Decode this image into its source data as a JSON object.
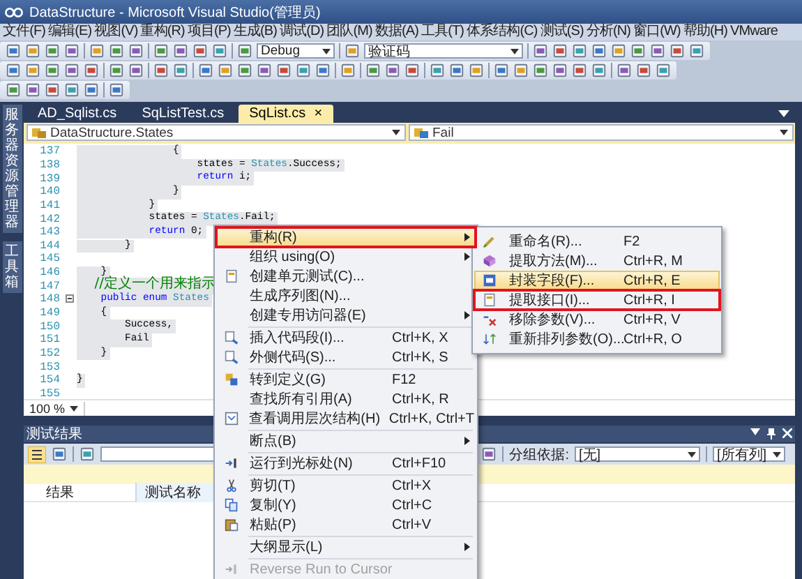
{
  "window": {
    "title": "DataStructure - Microsoft Visual Studio(管理员)"
  },
  "menu_bar": [
    "文件(F)",
    "编辑(E)",
    "视图(V)",
    "重构(R)",
    "项目(P)",
    "生成(B)",
    "调试(D)",
    "团队(M)",
    "数据(A)",
    "工具(T)",
    "体系结构(C)",
    "测试(S)",
    "分析(N)",
    "窗口(W)",
    "帮助(H)",
    "VMware"
  ],
  "toolbar": {
    "configuration": "Debug",
    "search_combo": "验证码"
  },
  "side_strip": [
    "服务器资源管理器",
    "工具箱"
  ],
  "tabs": [
    {
      "label": "AD_Sqlist.cs",
      "selected": false
    },
    {
      "label": "SqListTest.cs",
      "selected": false
    },
    {
      "label": "SqList.cs",
      "selected": true,
      "close": "×"
    }
  ],
  "nav_bar": {
    "type_combo": "DataStructure.States",
    "member_combo": "Fail"
  },
  "code_lines": [
    {
      "number": "137",
      "segments": [
        {
          "kind": "plain",
          "text": "                {"
        }
      ]
    },
    {
      "number": "138",
      "segments": [
        {
          "kind": "plain",
          "text": "                    states = "
        },
        {
          "kind": "type",
          "text": "States"
        },
        {
          "kind": "plain",
          "text": ".Success;"
        }
      ]
    },
    {
      "number": "139",
      "segments": [
        {
          "kind": "keyword",
          "text": "                    return"
        },
        {
          "kind": "plain",
          "text": " i;"
        }
      ]
    },
    {
      "number": "140",
      "segments": [
        {
          "kind": "plain",
          "text": "                }"
        }
      ]
    },
    {
      "number": "141",
      "segments": [
        {
          "kind": "plain",
          "text": "            }"
        }
      ]
    },
    {
      "number": "142",
      "segments": [
        {
          "kind": "plain",
          "text": "            states = "
        },
        {
          "kind": "type",
          "text": "States"
        },
        {
          "kind": "plain",
          "text": ".Fail;"
        }
      ]
    },
    {
      "number": "143",
      "segments": [
        {
          "kind": "keyword",
          "text": "            return"
        },
        {
          "kind": "plain",
          "text": " 0;"
        }
      ]
    },
    {
      "number": "144",
      "segments": [
        {
          "kind": "plain",
          "text": "        }"
        }
      ]
    },
    {
      "number": "145"
    },
    {
      "number": "146",
      "segments": [
        {
          "kind": "plain",
          "text": "    }"
        }
      ]
    },
    {
      "number": "147",
      "segments": [
        {
          "kind": "comment",
          "text": "    //定义一个用来指示"
        }
      ]
    },
    {
      "number": "148",
      "segments": [
        {
          "kind": "keyword",
          "text": "    public enum"
        },
        {
          "kind": "type",
          "text": " States"
        }
      ]
    },
    {
      "number": "149",
      "segments": [
        {
          "kind": "plain",
          "text": "    {"
        }
      ]
    },
    {
      "number": "150",
      "segments": [
        {
          "kind": "plain",
          "text": "        Success,"
        }
      ]
    },
    {
      "number": "151",
      "segments": [
        {
          "kind": "plain",
          "text": "        Fail"
        }
      ]
    },
    {
      "number": "152",
      "segments": [
        {
          "kind": "plain",
          "text": "    }"
        }
      ]
    },
    {
      "number": "153"
    },
    {
      "number": "154",
      "segments": [
        {
          "kind": "plain",
          "text": "}"
        }
      ]
    },
    {
      "number": "155"
    }
  ],
  "zoom": "100 %",
  "test_results": {
    "title": "测试结果",
    "group_label": "分组依据:",
    "group_combo": "[无]",
    "columns_combo": "[所有列]",
    "columns": [
      "结果",
      "测试名称"
    ]
  },
  "context_menu": [
    {
      "kind": "item",
      "label": "重构(R)",
      "submenu": true,
      "selected": true,
      "outlined": true,
      "disabled": false
    },
    {
      "kind": "item",
      "label": "组织 using(O)",
      "submenu": true,
      "selected": false,
      "outlined": false,
      "disabled": false
    },
    {
      "kind": "item",
      "label": "创建单元测试(C)...",
      "submenu": false,
      "selected": false,
      "outlined": false,
      "disabled": false
    },
    {
      "kind": "item",
      "label": "生成序列图(N)...",
      "submenu": false,
      "selected": false,
      "outlined": false,
      "disabled": false
    },
    {
      "kind": "item",
      "label": "创建专用访问器(E)",
      "submenu": true,
      "selected": false,
      "outlined": false,
      "disabled": false
    },
    {
      "kind": "separator"
    },
    {
      "kind": "item",
      "label": "插入代码段(I)...",
      "shortcut": "Ctrl+K, X",
      "submenu": false,
      "selected": false,
      "outlined": false,
      "disabled": false
    },
    {
      "kind": "item",
      "label": "外侧代码(S)...",
      "shortcut": "Ctrl+K, S",
      "submenu": false,
      "selected": false,
      "outlined": false,
      "disabled": false
    },
    {
      "kind": "separator"
    },
    {
      "kind": "item",
      "label": "转到定义(G)",
      "shortcut": "F12",
      "submenu": false,
      "selected": false,
      "outlined": false,
      "disabled": false
    },
    {
      "kind": "item",
      "label": "查找所有引用(A)",
      "shortcut": "Ctrl+K, R",
      "submenu": false,
      "selected": false,
      "outlined": false,
      "disabled": false
    },
    {
      "kind": "item",
      "label": "查看调用层次结构(H)",
      "shortcut": "Ctrl+K, Ctrl+T",
      "submenu": false,
      "selected": false,
      "outlined": false,
      "disabled": false
    },
    {
      "kind": "separator"
    },
    {
      "kind": "item",
      "label": "断点(B)",
      "submenu": true,
      "selected": false,
      "outlined": false,
      "disabled": false
    },
    {
      "kind": "separator"
    },
    {
      "kind": "item",
      "label": "运行到光标处(N)",
      "shortcut": "Ctrl+F10",
      "submenu": false,
      "selected": false,
      "outlined": false,
      "disabled": false
    },
    {
      "kind": "separator"
    },
    {
      "kind": "item",
      "label": "剪切(T)",
      "shortcut": "Ctrl+X",
      "submenu": false,
      "selected": false,
      "outlined": false,
      "disabled": false
    },
    {
      "kind": "item",
      "label": "复制(Y)",
      "shortcut": "Ctrl+C",
      "submenu": false,
      "selected": false,
      "outlined": false,
      "disabled": false
    },
    {
      "kind": "item",
      "label": "粘贴(P)",
      "shortcut": "Ctrl+V",
      "submenu": false,
      "selected": false,
      "outlined": false,
      "disabled": false
    },
    {
      "kind": "separator"
    },
    {
      "kind": "item",
      "label": "大纲显示(L)",
      "submenu": true,
      "selected": false,
      "outlined": false,
      "disabled": false
    },
    {
      "kind": "separator"
    },
    {
      "kind": "item",
      "label": "Reverse Run to Cursor",
      "submenu": false,
      "selected": false,
      "outlined": false,
      "disabled": true
    }
  ],
  "submenu": [
    {
      "label": "重命名(R)...",
      "shortcut": "F2",
      "selected": false,
      "outlined": false
    },
    {
      "label": "提取方法(M)...",
      "shortcut": "Ctrl+R, M",
      "selected": false,
      "outlined": false
    },
    {
      "label": "封装字段(F)...",
      "shortcut": "Ctrl+R, E",
      "selected": true,
      "outlined": false
    },
    {
      "label": "提取接口(I)...",
      "shortcut": "Ctrl+R, I",
      "selected": false,
      "outlined": true
    },
    {
      "label": "移除参数(V)...",
      "shortcut": "Ctrl+R, V",
      "selected": false,
      "outlined": false
    },
    {
      "label": "重新排列参数(O)...",
      "shortcut": "Ctrl+R, O",
      "selected": false,
      "outlined": false
    }
  ]
}
